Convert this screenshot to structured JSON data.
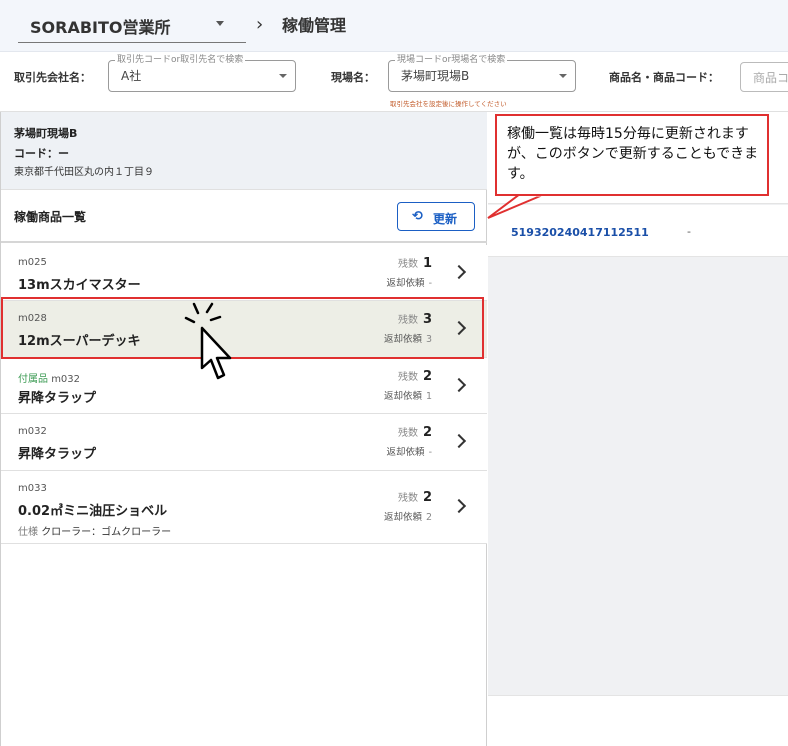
{
  "header": {
    "office": "SORABITO営業所",
    "separator": "›",
    "page_title": "稼働管理"
  },
  "filters": {
    "customer_label": "取引先会社名：",
    "customer_legend": "取引先コードor取引先名で検索",
    "customer_value": "A社",
    "site_label": "現場名：",
    "site_legend": "現場コードor現場名で検索",
    "site_value": "茅場町現場B",
    "site_hint": "取引先会社を設定後に操作してください",
    "product_label": "商品名・商品コード：",
    "product_placeholder": "商品コ"
  },
  "site": {
    "name": "茅場町現場B",
    "code": "コード：ー",
    "address": "東京都千代田区丸の内１丁目９"
  },
  "list": {
    "title": "稼働商品一覧",
    "refresh_label": "更新",
    "refresh_icon": "refresh-icon",
    "items": [
      {
        "accessory": "",
        "code": "m025",
        "name": "13mスカイマスター",
        "spec_label": "",
        "spec": "",
        "qty_label": "残数",
        "qty": "1",
        "return_label": "返却依頼",
        "return": "-"
      },
      {
        "accessory": "",
        "code": "m028",
        "name": "12mスーパーデッキ",
        "spec_label": "",
        "spec": "",
        "qty_label": "残数",
        "qty": "3",
        "return_label": "返却依頼",
        "return": "3"
      },
      {
        "accessory": "付属品",
        "code": "m032",
        "name": "昇降タラップ",
        "spec_label": "",
        "spec": "",
        "qty_label": "残数",
        "qty": "2",
        "return_label": "返却依頼",
        "return": "1"
      },
      {
        "accessory": "",
        "code": "m032",
        "name": "昇降タラップ",
        "spec_label": "",
        "spec": "",
        "qty_label": "残数",
        "qty": "2",
        "return_label": "返却依頼",
        "return": "-"
      },
      {
        "accessory": "",
        "code": "m033",
        "name": "0.02㎥ミニ油圧ショベル",
        "spec_label": "仕様",
        "spec": "クローラー：ゴムクローラー",
        "qty_label": "残数",
        "qty": "2",
        "return_label": "返却依頼",
        "return": "2"
      }
    ]
  },
  "detail": {
    "row": {
      "management_no": "519320240417112511",
      "value": "-"
    }
  },
  "callout": {
    "text": "稼働一覧は毎時15分毎に更新されますが、このボタンで更新することもできます。"
  },
  "colors": {
    "accent": "#1b5fc4",
    "highlight": "#e03030",
    "accessory": "#3a9a52"
  }
}
